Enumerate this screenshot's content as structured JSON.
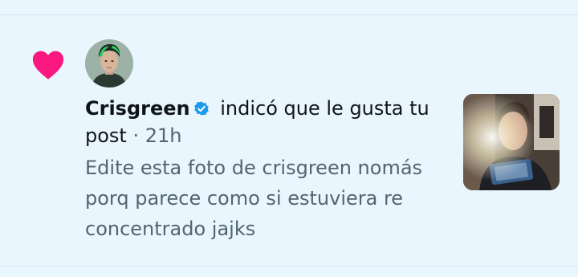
{
  "notification": {
    "icon": "heart-icon",
    "heart_color": "#f91880",
    "verified_color": "#1d9bf0",
    "user_name": "Crisgreen",
    "action_text": " indicó que le gusta tu post",
    "separator": " · ",
    "time_ago": "21h",
    "post_text": "Edite esta foto de crisgreen nomás porq parece como si estuviera re concentrado jajks"
  }
}
